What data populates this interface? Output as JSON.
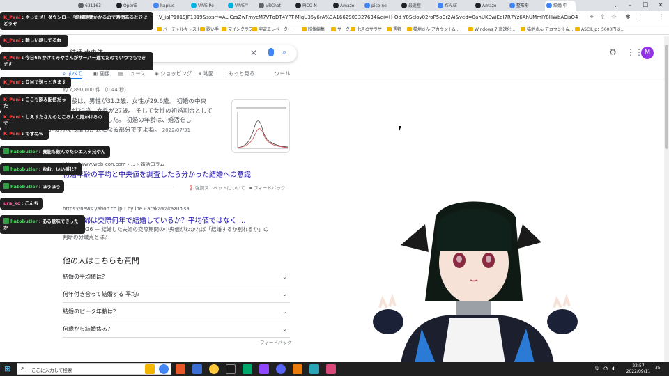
{
  "browser": {
    "tabs": [
      {
        "label": "631163",
        "color": "#5f6368"
      },
      {
        "label": "OpenE",
        "color": "#202124"
      },
      {
        "label": "hapluc",
        "color": "#4285f4"
      },
      {
        "label": "VIVE Po",
        "color": "#00b3e3"
      },
      {
        "label": "VIVE™",
        "color": "#00b3e3"
      },
      {
        "label": "VRChat",
        "color": "#5f6368"
      },
      {
        "label": "PICO N",
        "color": "#202124"
      },
      {
        "label": "Amazo",
        "color": "#202124"
      },
      {
        "label": "pico ne",
        "color": "#4285f4"
      },
      {
        "label": "最近登",
        "color": "#202124"
      },
      {
        "label": "だんぼ",
        "color": "#4285f4"
      },
      {
        "label": "Amazo",
        "color": "#202124"
      },
      {
        "label": "整形形",
        "color": "#4285f4"
      },
      {
        "label": "結婚 中",
        "color": "#4285f4"
      }
    ],
    "url": "V_jaJP1019JP1019&sxsrf=ALiCzsZwFmycM7VTqDT4YPT-MlqU35y6rA%3A1662903327634&ei=H-Qd Y8ScIoy02roP5oCr2Ai&ved=0ahUKEwiEqI7R7Yz6AhUMmIY8HWbACisQ4dUDCA4&uact=5&oq=...",
    "bookmarks": [
      "バーチャルキャスト",
      "歌い手",
      "マインクラフト",
      "宇宙エレベーター",
      "映像編集",
      "サークル",
      "七月のサラサ",
      "週特",
      "猫地さん アカウント&...",
      "Windows 7 高速化...",
      "猫地さん アカウント&...",
      "ASCII.jp：5000円以..."
    ],
    "profile_initial": "M"
  },
  "search": {
    "query": "結婚 中央値",
    "tabs": [
      {
        "label": "すべて",
        "icon": "search-icon"
      },
      {
        "label": "画像",
        "icon": "image-icon"
      },
      {
        "label": "ニュース",
        "icon": "news-icon"
      },
      {
        "label": "ショッピング",
        "icon": "tag-icon"
      },
      {
        "label": "地図",
        "icon": "pin-icon"
      },
      {
        "label": "もっと見る",
        "icon": "more-icon"
      },
      {
        "label": "ツール",
        "icon": ""
      }
    ],
    "stats": "約 7,890,000 件 （0.44 秒）",
    "snippet_lines": [
      "平均初婚年齢は、男性が31.2歳、女性が29.6歳。 初婚の中央",
      "値は、男性が29歳、女性が27歳。 そして女性の初婚割合として",
      "なっているという結果でした。 初婚の年齢は、婚活をし",
      "ている方なら誰もが気になる部分ですよね。"
    ],
    "snippet_date": "2022/07/31",
    "result1": {
      "source": "https://www.web-con.com › ... › 婚活コラム",
      "title": "初婚年齢の平均と中央値を調査したら分かった結婚への意識",
      "about": "強調スニペットについて",
      "feedback": "フィードバック"
    },
    "result2": {
      "source": "https://news.yahoo.co.jp › byline › arakawakazuhisa",
      "title": "その夫婦は交際何年で結婚しているか？平均値ではなく ...",
      "desc": "2022/03/26 — 結婚した夫婦の交際期間の中央値がわかれば「結婚するか別れるか」の判断の分岐点とは？"
    },
    "paa": {
      "title": "他の人はこちらも質問",
      "questions": [
        "結婚の平均値は？",
        "何年付き合って結婚する 平均？",
        "結婚のピーク年齢は？",
        "何歳から結婚焦る？"
      ],
      "feedback": "フィードバック"
    }
  },
  "chat": {
    "messages": [
      {
        "user": "K_Peni",
        "text": "やったぜ！ダウンロード結構時間かかるので時間あるときにどうぞ",
        "color": "#ff4d4d",
        "badge": false
      },
      {
        "user": "K_Peni",
        "text": "難しい話してるね",
        "color": "#ff4d4d",
        "badge": false
      },
      {
        "user": "K_Peni",
        "text": "今日6ｈかけてみやさんがサーバー建てたのでいつでもできます",
        "color": "#ff4d4d",
        "badge": false
      },
      {
        "user": "K_Peni",
        "text": "ＤＭで送っときます",
        "color": "#ff4d4d",
        "badge": false
      },
      {
        "user": "K_Peni",
        "text": "ここも飲み配信だった",
        "color": "#ff4d4d",
        "badge": false
      },
      {
        "user": "K_Peni",
        "text": "しえすたさんのところよく見かけるので",
        "color": "#ff4d4d",
        "badge": false
      },
      {
        "user": "K_Peni",
        "text": "ですねｗ",
        "color": "#ff4d4d",
        "badge": false
      },
      {
        "user": "hatobutler",
        "text": "機能も飲んでたシエスタ兄やん",
        "color": "#4cd964",
        "badge": true
      },
      {
        "user": "hatobutler",
        "text": "おお、いい感じ？",
        "color": "#4cd964",
        "badge": true
      },
      {
        "user": "hatobutler",
        "text": "ほうほう",
        "color": "#4cd964",
        "badge": true
      },
      {
        "user": "ura_kc",
        "text": "こんち",
        "color": "#ff6fa8",
        "badge": false
      },
      {
        "user": "hatobutler",
        "text": "ある意味できったか",
        "color": "#4cd964",
        "badge": true
      }
    ]
  },
  "taskbar": {
    "search_placeholder": "ここに入力して検索",
    "time": "22:57",
    "date": "2022/09/11",
    "notify_count": "35"
  }
}
